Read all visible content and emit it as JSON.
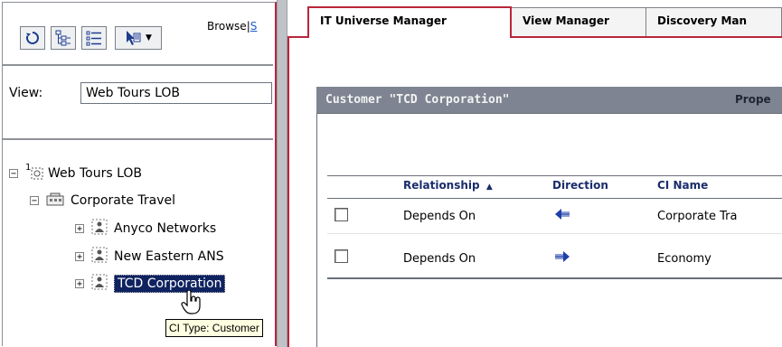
{
  "left_panel": {
    "toolbar": {
      "browse_label": "Browse",
      "browse_separator": "|",
      "browse_truncated": "S"
    },
    "view": {
      "label": "View:",
      "value": "Web Tours LOB"
    },
    "tree": {
      "root": {
        "label": "Web Tours LOB",
        "badge": "1"
      },
      "group": {
        "label": "Corporate Travel"
      },
      "items": [
        {
          "label": "Anyco Networks"
        },
        {
          "label": "New Eastern ANS"
        },
        {
          "label": "TCD Corporation"
        }
      ]
    },
    "tooltip": "CI Type: Customer"
  },
  "tabs": [
    {
      "label": "IT Universe Manager",
      "active": true
    },
    {
      "label": "View Manager",
      "active": false
    },
    {
      "label": "Discovery Man",
      "active": false
    }
  ],
  "details": {
    "title": "Customer \"TCD Corporation\"",
    "properties_label": "Prope",
    "table": {
      "columns": [
        "Relationship",
        "Direction",
        "CI Name"
      ],
      "sort_indicator": "▲",
      "rows": [
        {
          "relationship": "Depends On",
          "direction": "incoming",
          "ci_name": "Corporate Tra"
        },
        {
          "relationship": "Depends On",
          "direction": "outgoing",
          "ci_name": "Economy"
        }
      ]
    }
  },
  "colors": {
    "accent_red": "#b9263b",
    "header_gray": "#7e8491",
    "selection_navy": "#0f2260",
    "arrow_blue": "#1f3fa8",
    "tooltip_bg": "#ffffe1"
  }
}
